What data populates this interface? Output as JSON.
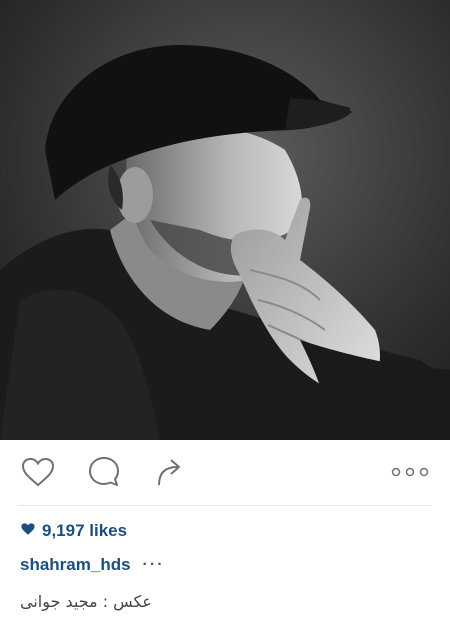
{
  "post": {
    "image": {
      "description_icon": "portrait-photo"
    },
    "actions": {
      "like_icon": "heart-outline-icon",
      "comment_icon": "comment-bubble-icon",
      "share_icon": "share-arrow-icon",
      "more_icon": "more-options-icon"
    },
    "likes_count": "9,197 likes",
    "username": "shahram_hds",
    "caption_more": "···",
    "credit_text": "عکس : مجید جوانی",
    "colors": {
      "link_blue": "#1c4f7f",
      "icon_gray": "#707070"
    }
  }
}
